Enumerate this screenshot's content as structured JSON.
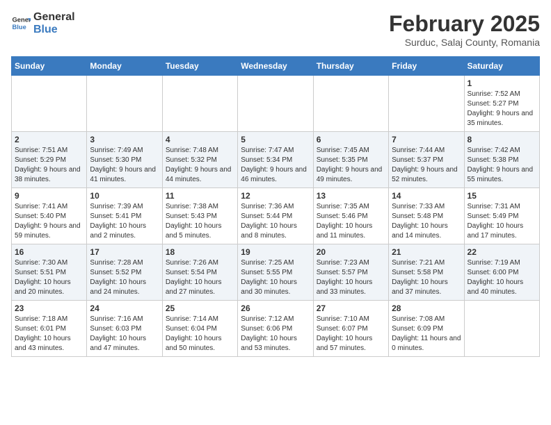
{
  "header": {
    "logo": {
      "line1": "General",
      "line2": "Blue"
    },
    "title": "February 2025",
    "subtitle": "Surduc, Salaj County, Romania"
  },
  "weekdays": [
    "Sunday",
    "Monday",
    "Tuesday",
    "Wednesday",
    "Thursday",
    "Friday",
    "Saturday"
  ],
  "weeks": [
    [
      {
        "day": "",
        "info": ""
      },
      {
        "day": "",
        "info": ""
      },
      {
        "day": "",
        "info": ""
      },
      {
        "day": "",
        "info": ""
      },
      {
        "day": "",
        "info": ""
      },
      {
        "day": "",
        "info": ""
      },
      {
        "day": "1",
        "info": "Sunrise: 7:52 AM\nSunset: 5:27 PM\nDaylight: 9 hours and 35 minutes."
      }
    ],
    [
      {
        "day": "2",
        "info": "Sunrise: 7:51 AM\nSunset: 5:29 PM\nDaylight: 9 hours and 38 minutes."
      },
      {
        "day": "3",
        "info": "Sunrise: 7:49 AM\nSunset: 5:30 PM\nDaylight: 9 hours and 41 minutes."
      },
      {
        "day": "4",
        "info": "Sunrise: 7:48 AM\nSunset: 5:32 PM\nDaylight: 9 hours and 44 minutes."
      },
      {
        "day": "5",
        "info": "Sunrise: 7:47 AM\nSunset: 5:34 PM\nDaylight: 9 hours and 46 minutes."
      },
      {
        "day": "6",
        "info": "Sunrise: 7:45 AM\nSunset: 5:35 PM\nDaylight: 9 hours and 49 minutes."
      },
      {
        "day": "7",
        "info": "Sunrise: 7:44 AM\nSunset: 5:37 PM\nDaylight: 9 hours and 52 minutes."
      },
      {
        "day": "8",
        "info": "Sunrise: 7:42 AM\nSunset: 5:38 PM\nDaylight: 9 hours and 55 minutes."
      }
    ],
    [
      {
        "day": "9",
        "info": "Sunrise: 7:41 AM\nSunset: 5:40 PM\nDaylight: 9 hours and 59 minutes."
      },
      {
        "day": "10",
        "info": "Sunrise: 7:39 AM\nSunset: 5:41 PM\nDaylight: 10 hours and 2 minutes."
      },
      {
        "day": "11",
        "info": "Sunrise: 7:38 AM\nSunset: 5:43 PM\nDaylight: 10 hours and 5 minutes."
      },
      {
        "day": "12",
        "info": "Sunrise: 7:36 AM\nSunset: 5:44 PM\nDaylight: 10 hours and 8 minutes."
      },
      {
        "day": "13",
        "info": "Sunrise: 7:35 AM\nSunset: 5:46 PM\nDaylight: 10 hours and 11 minutes."
      },
      {
        "day": "14",
        "info": "Sunrise: 7:33 AM\nSunset: 5:48 PM\nDaylight: 10 hours and 14 minutes."
      },
      {
        "day": "15",
        "info": "Sunrise: 7:31 AM\nSunset: 5:49 PM\nDaylight: 10 hours and 17 minutes."
      }
    ],
    [
      {
        "day": "16",
        "info": "Sunrise: 7:30 AM\nSunset: 5:51 PM\nDaylight: 10 hours and 20 minutes."
      },
      {
        "day": "17",
        "info": "Sunrise: 7:28 AM\nSunset: 5:52 PM\nDaylight: 10 hours and 24 minutes."
      },
      {
        "day": "18",
        "info": "Sunrise: 7:26 AM\nSunset: 5:54 PM\nDaylight: 10 hours and 27 minutes."
      },
      {
        "day": "19",
        "info": "Sunrise: 7:25 AM\nSunset: 5:55 PM\nDaylight: 10 hours and 30 minutes."
      },
      {
        "day": "20",
        "info": "Sunrise: 7:23 AM\nSunset: 5:57 PM\nDaylight: 10 hours and 33 minutes."
      },
      {
        "day": "21",
        "info": "Sunrise: 7:21 AM\nSunset: 5:58 PM\nDaylight: 10 hours and 37 minutes."
      },
      {
        "day": "22",
        "info": "Sunrise: 7:19 AM\nSunset: 6:00 PM\nDaylight: 10 hours and 40 minutes."
      }
    ],
    [
      {
        "day": "23",
        "info": "Sunrise: 7:18 AM\nSunset: 6:01 PM\nDaylight: 10 hours and 43 minutes."
      },
      {
        "day": "24",
        "info": "Sunrise: 7:16 AM\nSunset: 6:03 PM\nDaylight: 10 hours and 47 minutes."
      },
      {
        "day": "25",
        "info": "Sunrise: 7:14 AM\nSunset: 6:04 PM\nDaylight: 10 hours and 50 minutes."
      },
      {
        "day": "26",
        "info": "Sunrise: 7:12 AM\nSunset: 6:06 PM\nDaylight: 10 hours and 53 minutes."
      },
      {
        "day": "27",
        "info": "Sunrise: 7:10 AM\nSunset: 6:07 PM\nDaylight: 10 hours and 57 minutes."
      },
      {
        "day": "28",
        "info": "Sunrise: 7:08 AM\nSunset: 6:09 PM\nDaylight: 11 hours and 0 minutes."
      },
      {
        "day": "",
        "info": ""
      }
    ]
  ]
}
